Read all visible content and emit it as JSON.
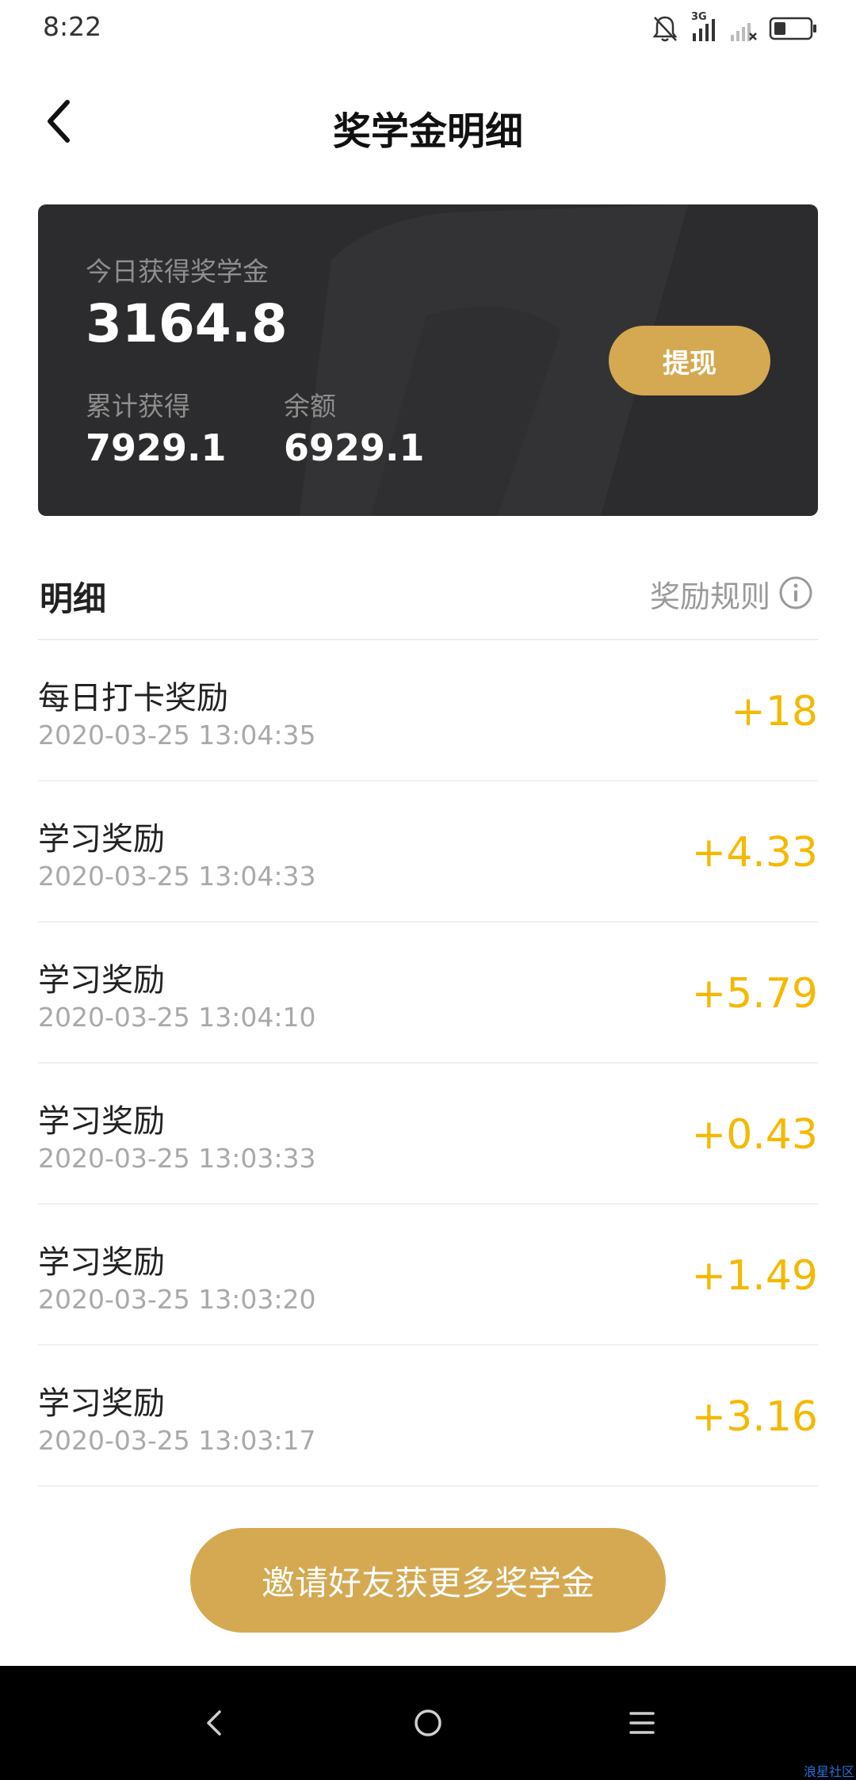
{
  "status_bar": {
    "time": "8:22",
    "network_label": "3G"
  },
  "header": {
    "title": "奖学金明细"
  },
  "summary": {
    "today_label": "今日获得奖学金",
    "today_value": "3164.8",
    "total_label": "累计获得",
    "total_value": "7929.1",
    "balance_label": "余额",
    "balance_value": "6929.1",
    "withdraw_label": "提现"
  },
  "detail": {
    "title": "明细",
    "rules_label": "奖励规则"
  },
  "records": [
    {
      "name": "每日打卡奖励",
      "time": "2020-03-25 13:04:35",
      "amount": "+18"
    },
    {
      "name": "学习奖励",
      "time": "2020-03-25 13:04:33",
      "amount": "+4.33"
    },
    {
      "name": "学习奖励",
      "time": "2020-03-25 13:04:10",
      "amount": "+5.79"
    },
    {
      "name": "学习奖励",
      "time": "2020-03-25 13:03:33",
      "amount": "+0.43"
    },
    {
      "name": "学习奖励",
      "time": "2020-03-25 13:03:20",
      "amount": "+1.49"
    },
    {
      "name": "学习奖励",
      "time": "2020-03-25 13:03:17",
      "amount": "+3.16"
    }
  ],
  "invite": {
    "label": "邀请好友获更多奖学金"
  },
  "footer": {
    "corner_text": "浪星社区"
  },
  "colors": {
    "accent_gold": "#d4a952",
    "amount_yellow": "#f5b800",
    "card_dark": "#2c2c2e"
  },
  "icons": {
    "back": "chevron-left-icon",
    "info": "info-circle-icon",
    "mute": "bell-off-icon",
    "signal": "signal-icon",
    "battery": "battery-icon"
  }
}
